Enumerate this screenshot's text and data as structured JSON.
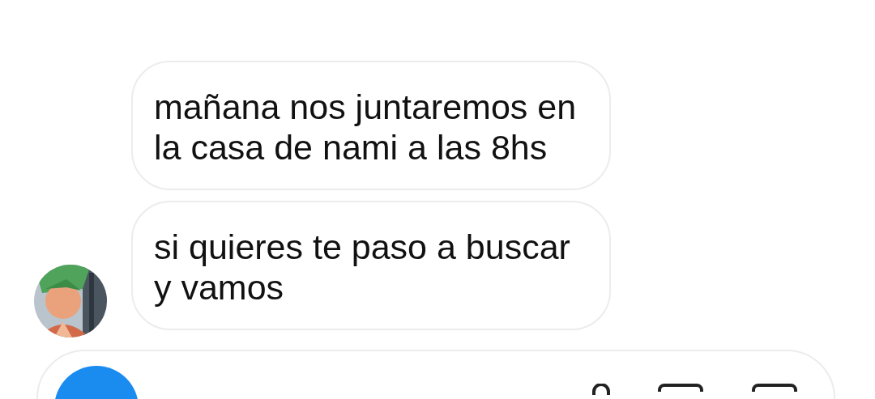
{
  "messages": [
    {
      "text": "mañana nos juntaremos en la casa de nami a las 8hs"
    },
    {
      "text": "si quieres te paso a buscar y vamos"
    }
  ]
}
